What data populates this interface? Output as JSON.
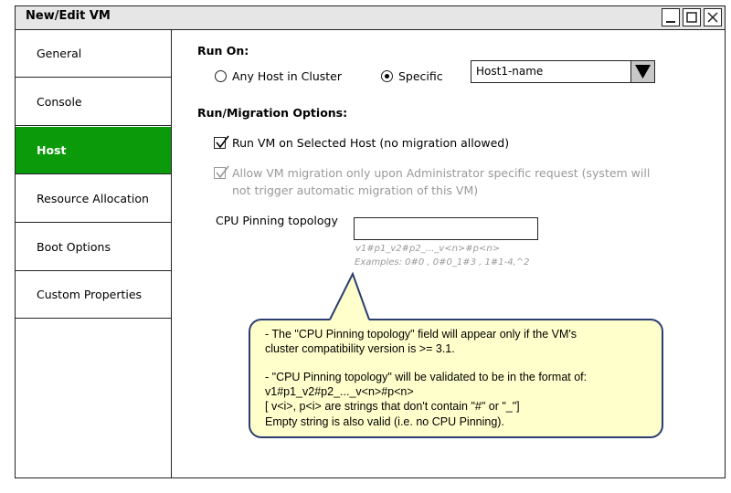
{
  "window": {
    "title": "New/Edit VM"
  },
  "sidebar": {
    "items": [
      {
        "label": "General",
        "active": false
      },
      {
        "label": "Console",
        "active": false
      },
      {
        "label": "Host",
        "active": true
      },
      {
        "label": "Resource Allocation",
        "active": false
      },
      {
        "label": "Boot Options",
        "active": false
      },
      {
        "label": "Custom Properties",
        "active": false
      }
    ]
  },
  "run_on": {
    "heading": "Run On:",
    "option_any": "Any Host in Cluster",
    "option_specific": "Specific",
    "selected": "specific",
    "host_select_value": "Host1-name"
  },
  "migration": {
    "heading": "Run/Migration Options:",
    "run_on_selected": {
      "label": "Run VM on Selected Host (no migration allowed)",
      "checked": true
    },
    "allow_migration": {
      "label_line1": "Allow VM migration only upon Administrator specific request (system will",
      "label_line2": "not trigger automatic migration of this VM)",
      "checked": true,
      "disabled": true
    }
  },
  "cpu_pinning": {
    "label": "CPU Pinning topology",
    "value": "",
    "hint_format": "v1#p1_v2#p2_..._v<n>#p<n>",
    "hint_examples": "Examples: 0#0 , 0#0_1#3 , 1#1-4,^2"
  },
  "callout": {
    "lines": [
      "- The \"CPU Pinning topology\" field will appear only if the VM's",
      "cluster compatibility version is >= 3.1.",
      "",
      "- \"CPU Pinning topology\" will be validated to be in the format of:",
      "v1#p1_v2#p2_..._v<n>#p<n>",
      "[ v<i>, p<i> are strings that don't contain \"#\" or \"_\"]",
      "Empty string is also valid (i.e. no CPU Pinning)."
    ]
  },
  "colors": {
    "active_nav": "#0a9a0a",
    "callout_bg": "#ffffcc",
    "callout_border": "#2c3e70"
  }
}
